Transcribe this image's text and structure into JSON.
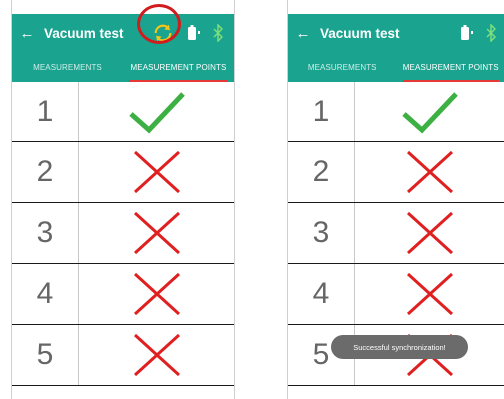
{
  "colors": {
    "accent": "#1aa38f",
    "tab_underline": "#e53935",
    "check": "#3cb043",
    "cross": "#e02020",
    "highlight": "#d01c1c"
  },
  "screens": [
    {
      "title": "Vacuum test",
      "back_icon": "arrow-left-icon",
      "tabs": [
        {
          "label": "MEASUREMENTS",
          "active": false
        },
        {
          "label": "MEASUREMENT POINTS",
          "active": true
        }
      ],
      "rows": [
        {
          "number": "1",
          "status": "check"
        },
        {
          "number": "2",
          "status": "cross"
        },
        {
          "number": "3",
          "status": "cross"
        },
        {
          "number": "4",
          "status": "cross"
        },
        {
          "number": "5",
          "status": "cross"
        }
      ]
    },
    {
      "title": "Vacuum test",
      "back_icon": "arrow-left-icon",
      "tabs": [
        {
          "label": "MEASUREMENTS",
          "active": false
        },
        {
          "label": "MEASUREMENT POINTS",
          "active": true
        }
      ],
      "rows": [
        {
          "number": "1",
          "status": "check"
        },
        {
          "number": "2",
          "status": "cross"
        },
        {
          "number": "3",
          "status": "cross"
        },
        {
          "number": "4",
          "status": "cross"
        },
        {
          "number": "5",
          "status": "cross"
        }
      ],
      "toast": "Successful synchronization!"
    }
  ]
}
